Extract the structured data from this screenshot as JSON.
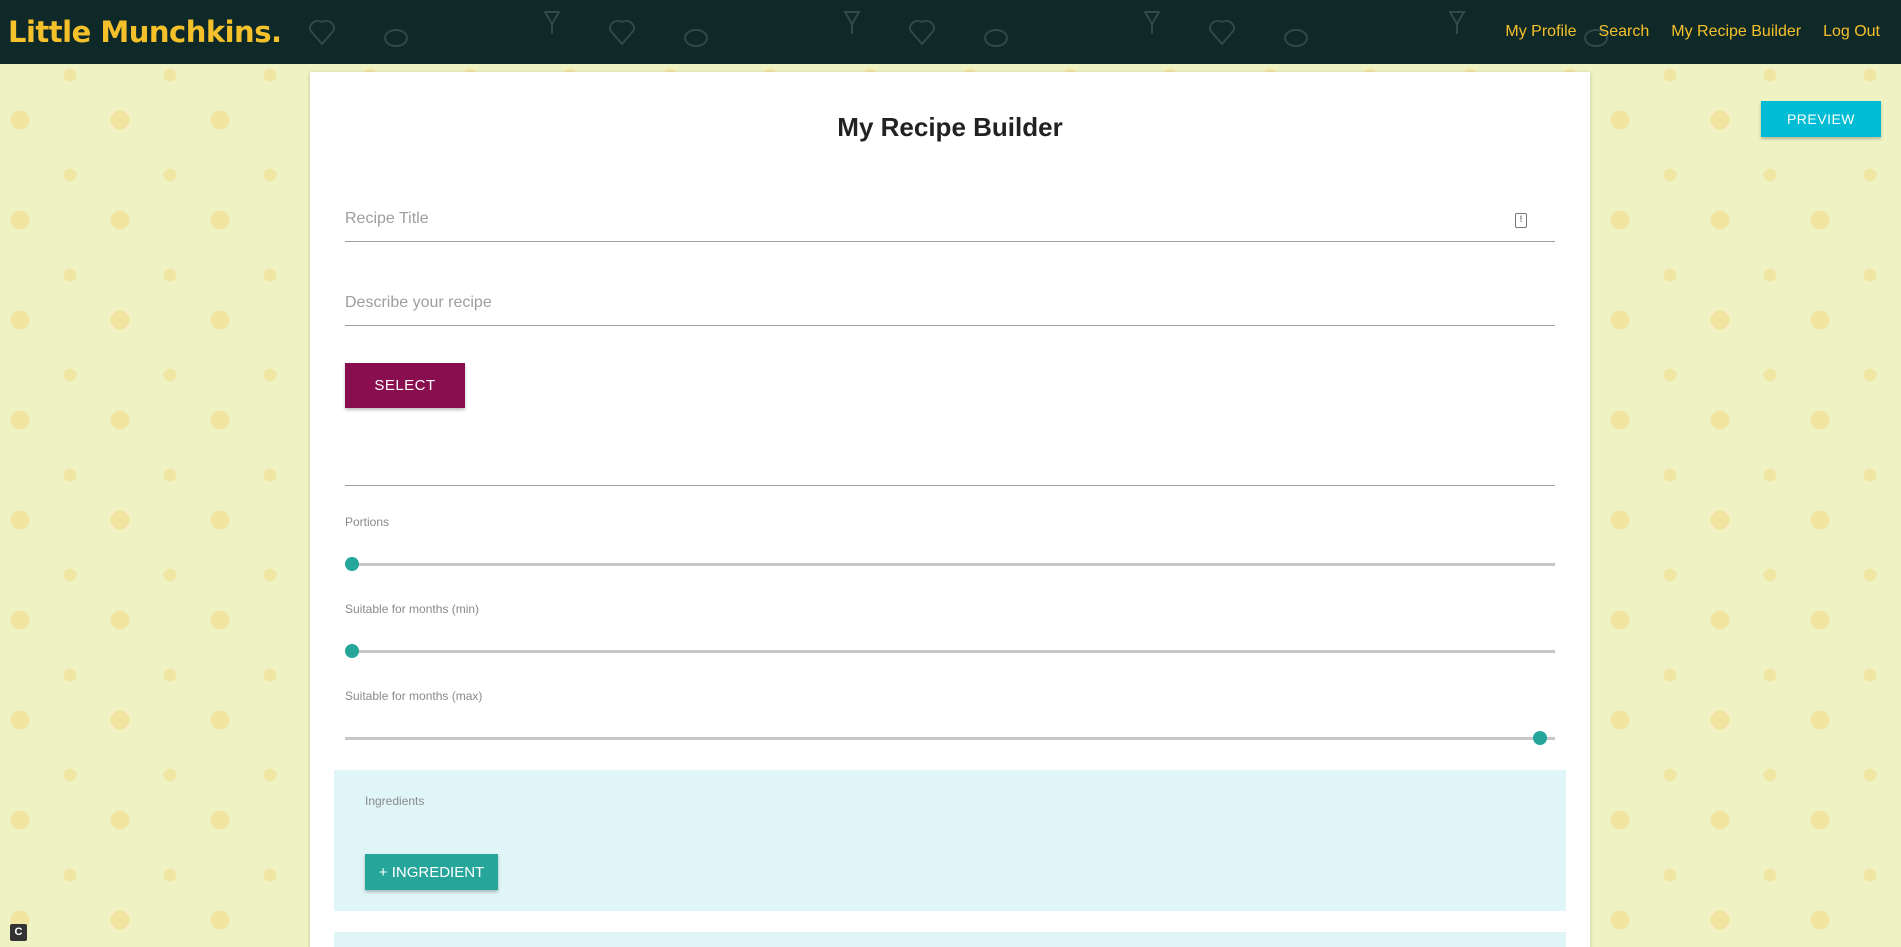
{
  "nav": {
    "brand": "Little Munchkins.",
    "links": [
      "My Profile",
      "Search",
      "My Recipe Builder",
      "Log Out"
    ]
  },
  "toolbar": {
    "preview_label": "PREVIEW"
  },
  "form": {
    "title": "My Recipe Builder",
    "recipe_title_placeholder": "Recipe Title",
    "recipe_title_value": "",
    "description_placeholder": "Describe your recipe",
    "description_value": "",
    "select_label": "SELECT",
    "sliders": [
      {
        "label": "Portions",
        "value_fraction": 0.0
      },
      {
        "label": "Suitable for months (min)",
        "value_fraction": 0.0
      },
      {
        "label": "Suitable for months (max)",
        "value_fraction": 1.0
      }
    ],
    "ingredients": {
      "label": "Ingredients",
      "add_label": "+ INGREDIENT"
    }
  },
  "colors": {
    "nav_bg": "#0f2828",
    "brand": "#f5c12b",
    "preview": "#00bcd4",
    "select": "#880e4f",
    "accent": "#26a69a",
    "ingredients_bg": "#dff5f7"
  },
  "icons": {
    "title_input_icon": "clipboard-icon",
    "corner_icon": "c-letter-icon"
  }
}
